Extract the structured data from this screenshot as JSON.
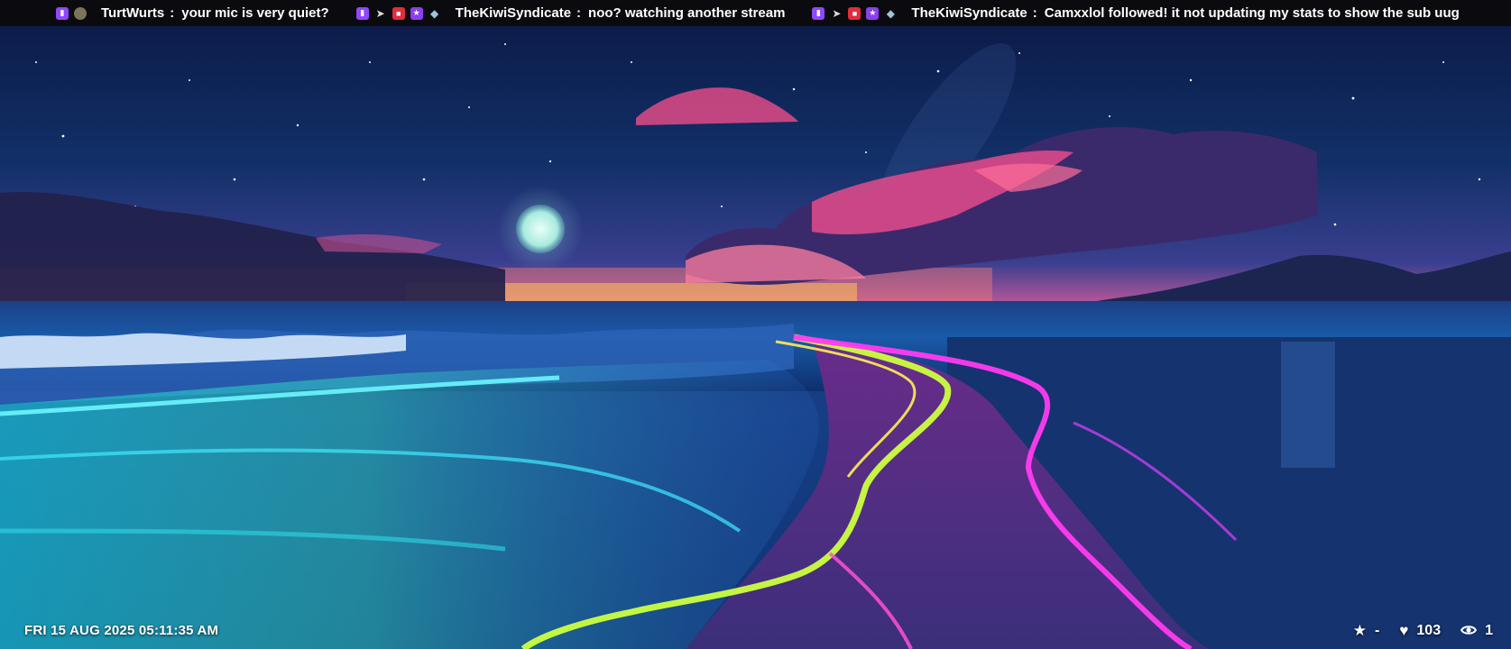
{
  "ticker": {
    "messages": [
      {
        "username": "TurtWurts",
        "text": "your mic is very quiet?"
      },
      {
        "username": "TheKiwiSyndicate",
        "text": "noo?  watching another stream"
      },
      {
        "username": "TheKiwiSyndicate",
        "text": "Camxxlol followed!  it not updating my stats to show the sub uug"
      }
    ]
  },
  "icons": {
    "twitch": "twitch-icon",
    "avatar": "avatar",
    "cursor": "cursor-icon",
    "camera": "camera-icon",
    "star": "star-icon",
    "gem": "gem-icon",
    "heart": "heart-icon",
    "eye": "eye-icon"
  },
  "colors": {
    "twitch": "#9146ff",
    "camera_badge": "#e52b3c",
    "ticker_bg": "#0b0b0f"
  },
  "clock": {
    "datetime": "FRI 15 AUG 2025 05:11:35 AM"
  },
  "stats": {
    "followers": "-",
    "likes": "103",
    "viewers": "1"
  }
}
